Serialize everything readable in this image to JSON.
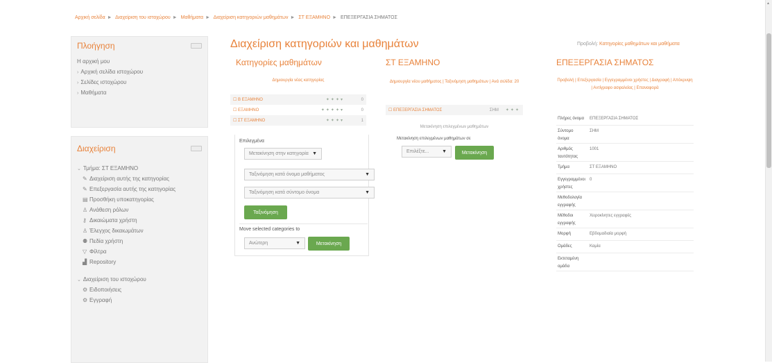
{
  "breadcrumb": [
    "Αρχική σελίδα",
    "Διαχείριση του ιστοχώρου",
    "Μαθήματα",
    "Διαχείριση κατηγοριών μαθημάτων",
    "ΣΤ ΕΞΑΜΗΝΟ",
    "ΕΠΕΞΕΡΓΑΣΙΑ ΣΗΜΑΤΟΣ"
  ],
  "nav_block": {
    "title": "Πλοήγηση",
    "items": [
      "Η αρχική μου",
      "Αρχική σελίδα ιστοχώρου",
      "Σελίδες ιστοχώρου",
      "Μαθήματα"
    ]
  },
  "admin_block": {
    "title": "Διαχείριση",
    "category_label": "Τμήμα: ΣΤ ΕΞΑΜΗΝΟ",
    "category_items": [
      "Διαχείριση αυτής της κατηγορίας",
      "Επεξεργασία αυτής της κατηγορίας",
      "Προσθήκη υποκατηγορίας",
      "Ανάθεση ρόλων",
      "Δικαιώματα χρήστη",
      "Έλεγχος δικαιωμάτων",
      "Πεδία χρήστη",
      "Φίλτρα",
      "Repository"
    ],
    "site_label": "Διαχείριση του ιστοχώρου",
    "site_items": [
      "Ειδοποιήσεις",
      "Εγγραφή"
    ]
  },
  "page_title": "Διαχείριση κατηγοριών και μαθημάτων",
  "view_link": {
    "prefix": "Προβολή:",
    "link": "Κατηγορίες μαθημάτων και μαθήματα"
  },
  "categories": {
    "title": "Κατηγορίες μαθημάτων",
    "create_link": "Δημιουργία νέας κατηγορίας",
    "rows": [
      {
        "name": "Β ΕΞΑΜΗΝΟ",
        "count": "0"
      },
      {
        "name": "ΕΞΑΜΗΝΟ",
        "count": "0"
      },
      {
        "name": "ΣΤ ΕΞΑΜΗΝΟ",
        "count": "1"
      }
    ],
    "selected_label": "Επιλεγμένα",
    "select1": "Μετακίνηση στην κατηγορία",
    "select2": "Ταξινόμηση κατά όνομα μαθήματος",
    "select3": "Ταξινόμηση κατά σύντομο όνομα",
    "sort_button": "Ταξινόμηση",
    "move_label": "Move selected categories to",
    "move_select": "Ανώτερη",
    "move_button": "Μετακίνηση"
  },
  "courses": {
    "title": "ΣΤ ΕΞΑΜΗΝΟ",
    "links": "Δημιουργία νέου μαθήματος | Ταξινόμηση μαθημάτων | Ανά σελίδα: 20",
    "row_name": "ΕΠΕΞΕΡΓΑΣΙΑ ΣΗΜΑΤΟΣ",
    "row_code": "ΣΗΜ",
    "hint": "Μετακίνηση επιλεγμένων μαθημάτων",
    "move_label": "Μετακίνηση επιλεγμένων μαθημάτων σε",
    "move_select": "Επιλέξτε...",
    "move_button": "Μετακίνηση"
  },
  "details": {
    "title": "ΕΠΕΞΕΡΓΑΣΙΑ ΣΗΜΑΤΟΣ",
    "actions": "Προβολή | Επεξεργασία | Εγγεγραμμένοι χρήστες | Διαγραφή | Απόκρυψη | Αντίγραφο ασφαλείας | Επαναφορά",
    "rows": [
      {
        "k": "Πλήρες όνομα",
        "v": "ΕΠΕΞΕΡΓΑΣΙΑ ΣΗΜΑΤΟΣ"
      },
      {
        "k": "Σύντομο όνομα",
        "v": "ΣΗΜ"
      },
      {
        "k": "Αριθμός ταυτότητας",
        "v": "1001"
      },
      {
        "k": "Τμήμα",
        "v": "ΣΤ ΕΞΑΜΗΝΟ"
      },
      {
        "k": "Εγγεγραμμένοι χρήστες",
        "v": "0"
      },
      {
        "k": "Μεθοδολογία εγγραφής",
        "v": ""
      },
      {
        "k": "Μέθοδοι εγγραφής",
        "v": "Χειροκίνητες εγγραφές"
      },
      {
        "k": "Μορφή",
        "v": "Εβδομαδιαία μορφή"
      },
      {
        "k": "Ομάδες",
        "v": "Καμία"
      },
      {
        "k": "Εκτεταμένη ομάδα",
        "v": ""
      }
    ]
  },
  "colors": {
    "accent": "#e8823a",
    "button": "#6aa84f",
    "block_bg": "#f2f2f2"
  }
}
